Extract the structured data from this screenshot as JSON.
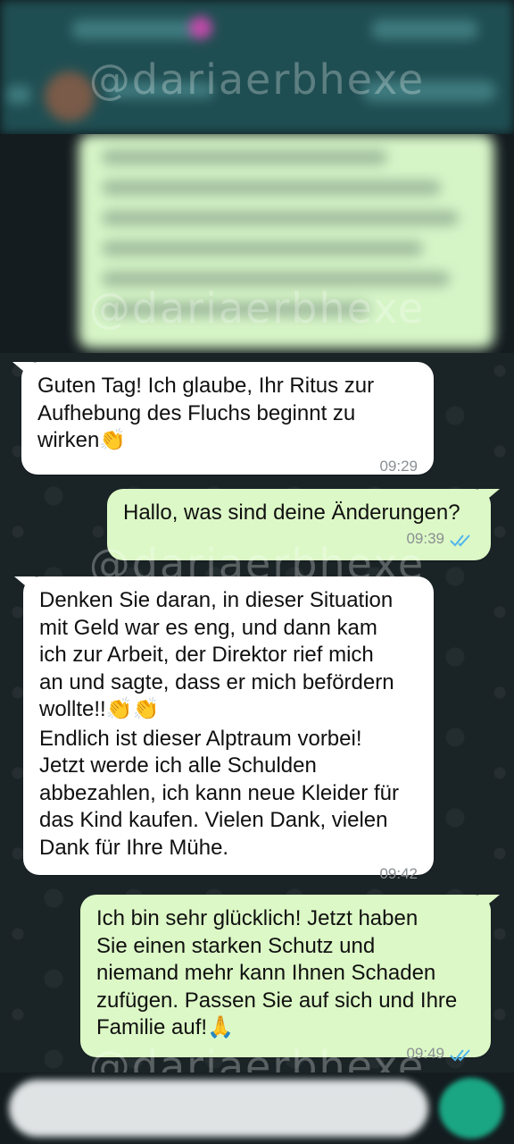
{
  "watermark": "@dariaerbhexe",
  "messages": [
    {
      "direction": "incoming",
      "text": "Guten Tag! Ich glaube, Ihr Ritus zur\nAufhebung des Fluchs beginnt zu\nwirken",
      "emoji": "👏",
      "time": "09:29"
    },
    {
      "direction": "outgoing",
      "text": "Hallo, was sind deine Änderungen?",
      "time": "09:39",
      "read": true
    },
    {
      "direction": "incoming",
      "text": "Denken Sie daran, in dieser Situation\nmit Geld war es eng, und dann kam\nich zur Arbeit, der Direktor rief mich\nan und sagte, dass er mich befördern\nwollte!!",
      "emoji": "👏👏",
      "text2": "Endlich ist dieser Alptraum vorbei!\nJetzt werde ich alle Schulden\nabbezahlen, ich kann neue Kleider für\ndas Kind kaufen. Vielen Dank, vielen\nDank für Ihre Mühe.",
      "time": "09:42"
    },
    {
      "direction": "outgoing",
      "text": "Ich bin sehr glücklich! Jetzt haben\nSie einen starken Schutz und\nniemand mehr kann Ihnen Schaden\nzufügen. Passen Sie auf sich und Ihre\nFamilie auf!",
      "emoji": "🙏",
      "time": "09:49",
      "read": true
    }
  ],
  "colors": {
    "incoming_bubble": "#ffffff",
    "outgoing_bubble": "#dcf8c6",
    "read_ticks": "#4fb6ec",
    "header": "#1f4e52",
    "send_button": "#1aa683"
  },
  "icons": {
    "read_receipt": "double-check-icon",
    "send": "mic-icon"
  }
}
